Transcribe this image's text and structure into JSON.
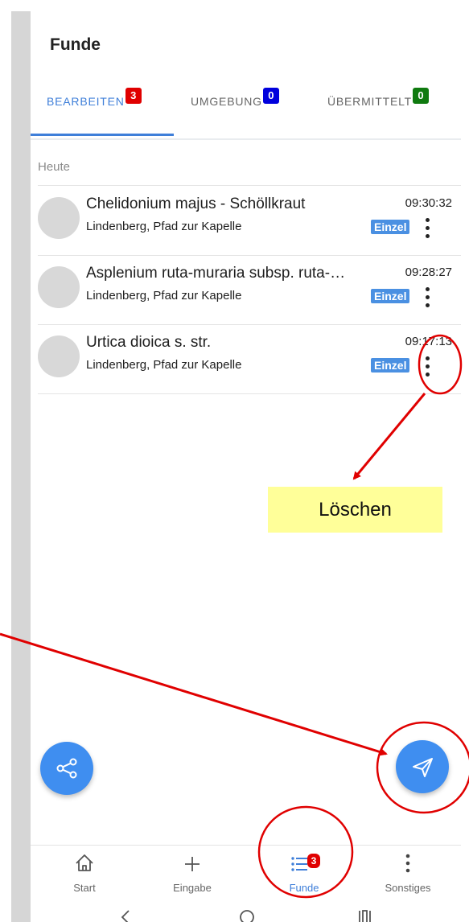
{
  "app": {
    "title": "Funde"
  },
  "tabs": [
    {
      "label": "BEARBEITEN",
      "badge": "3",
      "badge_color": "#e00000"
    },
    {
      "label": "UMGEBUNG",
      "badge": "0",
      "badge_color": "#0000dd"
    },
    {
      "label": "ÜBERMITTELT",
      "badge": "0",
      "badge_color": "#0f7a0f"
    }
  ],
  "section": {
    "label": "Heute"
  },
  "records": [
    {
      "name": "Chelidonium majus - Schöllkraut",
      "location": "Lindenberg, Pfad zur Kapelle",
      "time": "09:30:32",
      "tag": "Einzel"
    },
    {
      "name": "Asplenium ruta-muraria subsp. ruta-…",
      "location": "Lindenberg, Pfad zur Kapelle",
      "time": "09:28:27",
      "tag": "Einzel"
    },
    {
      "name": "Urtica dioica s. str.",
      "location": "Lindenberg, Pfad zur Kapelle",
      "time": "09:17:13",
      "tag": "Einzel"
    }
  ],
  "fabs": {
    "share_icon": "share-icon",
    "send_icon": "send-icon"
  },
  "bottom_nav": [
    {
      "label": "Start",
      "icon": "home-icon"
    },
    {
      "label": "Eingabe",
      "icon": "plus-icon"
    },
    {
      "label": "Funde",
      "icon": "list-icon",
      "badge": "3"
    },
    {
      "label": "Sonstiges",
      "icon": "more-vertical-icon"
    }
  ],
  "annotation": {
    "callout_text": "Löschen",
    "color": "#e00000"
  },
  "colors": {
    "accent": "#3f7fd9",
    "fab": "#3f8ef0",
    "chip": "#4a90e2"
  }
}
